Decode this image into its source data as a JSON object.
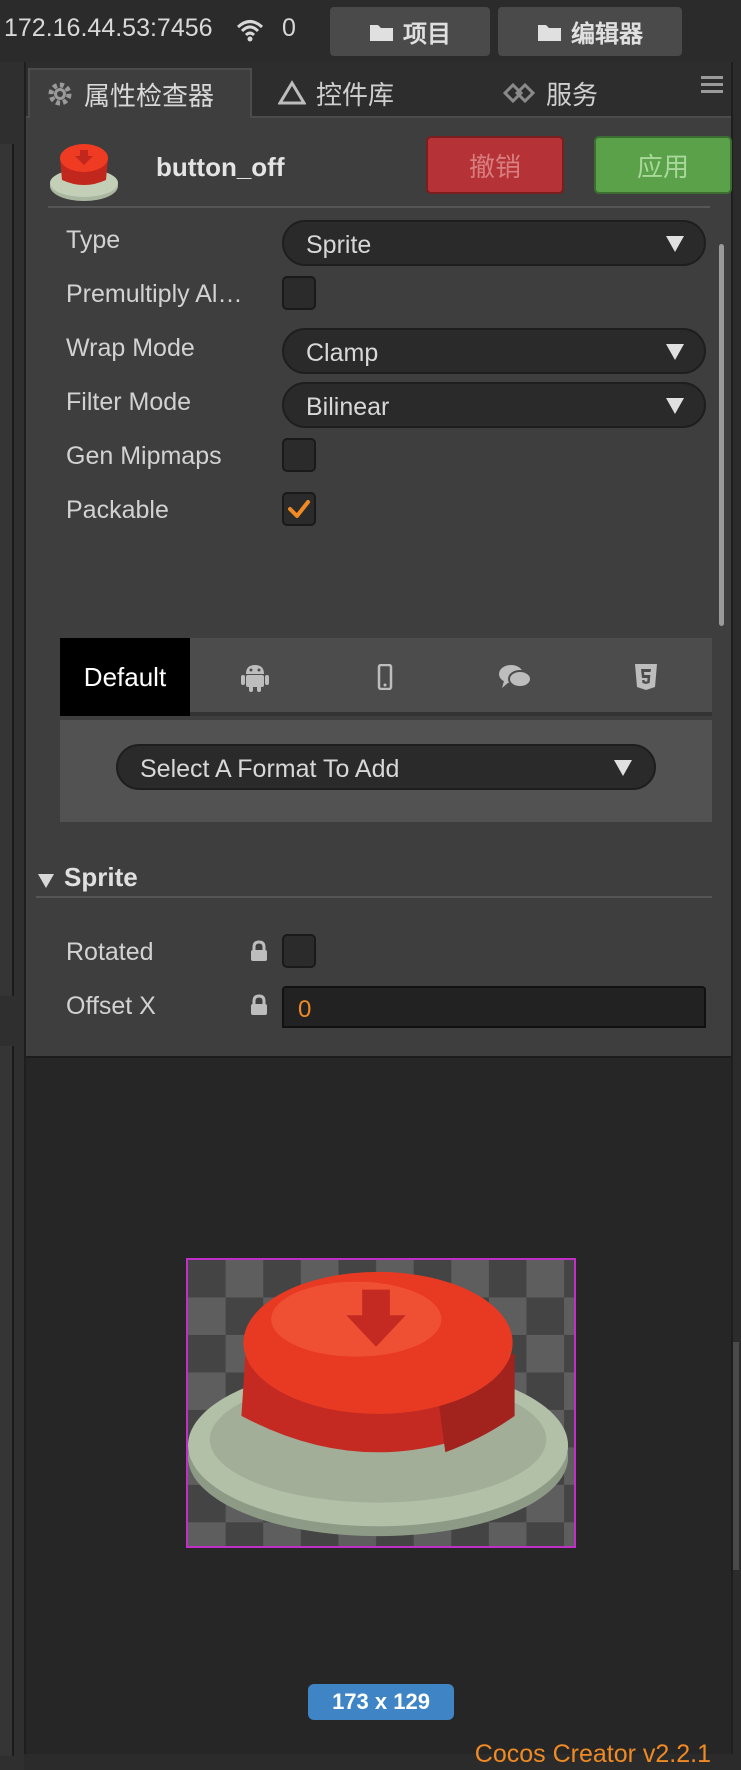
{
  "topbar": {
    "ip": "172.16.44.53:7456",
    "count": "0",
    "project_label": "项目",
    "editor_label": "编辑器"
  },
  "tabs": [
    {
      "label": "属性检查器",
      "icon": "gear-icon"
    },
    {
      "label": "控件库",
      "icon": "triangle-icon"
    },
    {
      "label": "服务",
      "icon": "service-icon"
    }
  ],
  "asset": {
    "name": "button_off",
    "revert_label": "撤销",
    "apply_label": "应用"
  },
  "properties": {
    "type": {
      "label": "Type",
      "value": "Sprite"
    },
    "premultiply": {
      "label": "Premultiply Al…",
      "checked": false
    },
    "wrap_mode": {
      "label": "Wrap Mode",
      "value": "Clamp"
    },
    "filter_mode": {
      "label": "Filter Mode",
      "value": "Bilinear"
    },
    "gen_mipmaps": {
      "label": "Gen Mipmaps",
      "checked": false
    },
    "packable": {
      "label": "Packable",
      "checked": true
    }
  },
  "platform_tabs": {
    "default_label": "Default",
    "icons": [
      "android-icon",
      "mobile-icon",
      "chat-icon",
      "html5-icon"
    ],
    "format_placeholder": "Select A Format To Add"
  },
  "sprite_section": {
    "title": "Sprite",
    "rotated": {
      "label": "Rotated",
      "checked": false
    },
    "offset_x": {
      "label": "Offset X",
      "value": "0"
    }
  },
  "preview": {
    "dimensions": "173 x 129"
  },
  "footer": {
    "version": "Cocos Creator v2.2.1"
  },
  "colors": {
    "revert": "#b53236",
    "apply": "#5aa14a",
    "accent_orange": "#f08a24",
    "dims_badge": "#3f84c5",
    "preview_border": "#c12fc8"
  }
}
